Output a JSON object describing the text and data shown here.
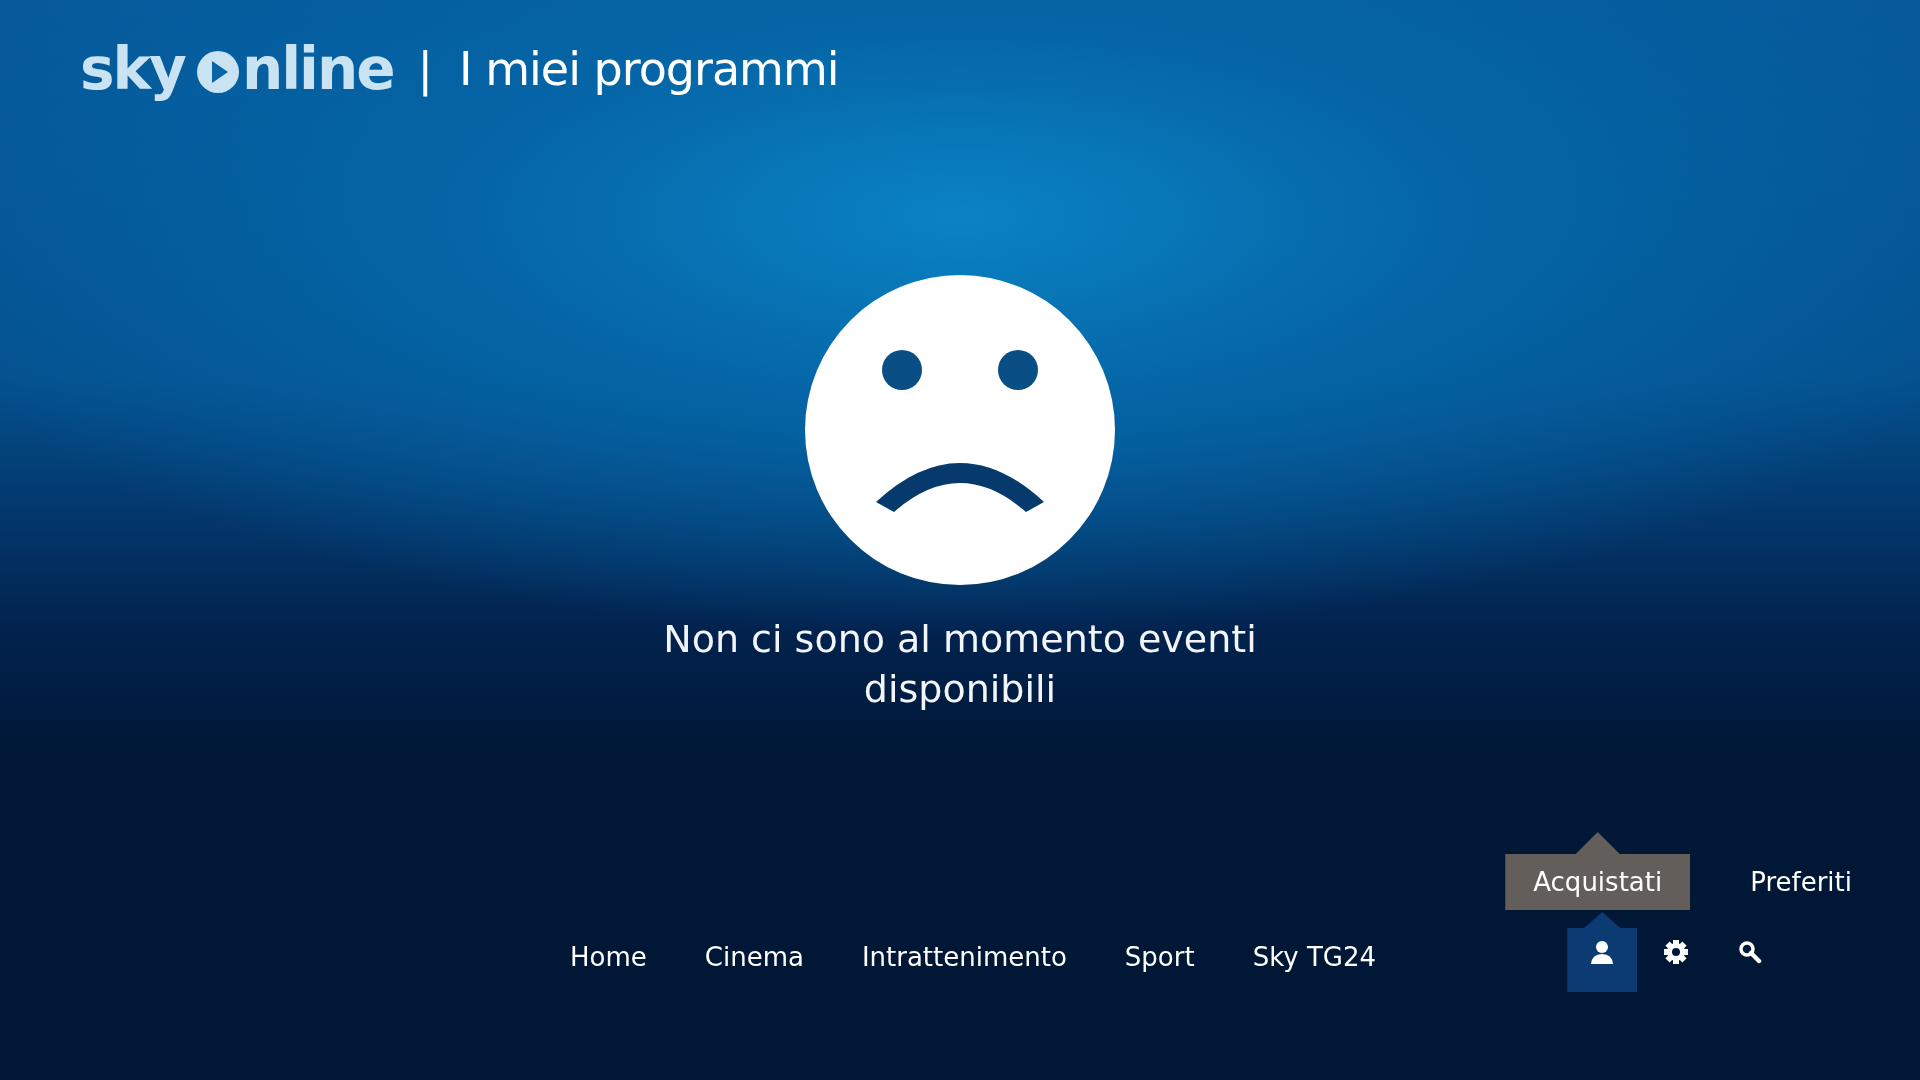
{
  "header": {
    "logo": {
      "brand": "sky",
      "product": "nline"
    },
    "separator": "|",
    "title": "I miei programmi"
  },
  "empty_state": {
    "message": "Non ci sono al momento eventi disponibili"
  },
  "nav": {
    "items": [
      {
        "label": "Home"
      },
      {
        "label": "Cinema"
      },
      {
        "label": "Intrattenimento"
      },
      {
        "label": "Sport"
      },
      {
        "label": "Sky TG24"
      }
    ]
  },
  "submenu": {
    "items": [
      {
        "label": "Acquistati",
        "selected": true
      },
      {
        "label": "Preferiti",
        "selected": false
      }
    ]
  },
  "icons": [
    {
      "kind": "user",
      "selected": true
    },
    {
      "kind": "settings",
      "selected": false
    },
    {
      "kind": "search",
      "selected": false
    }
  ]
}
